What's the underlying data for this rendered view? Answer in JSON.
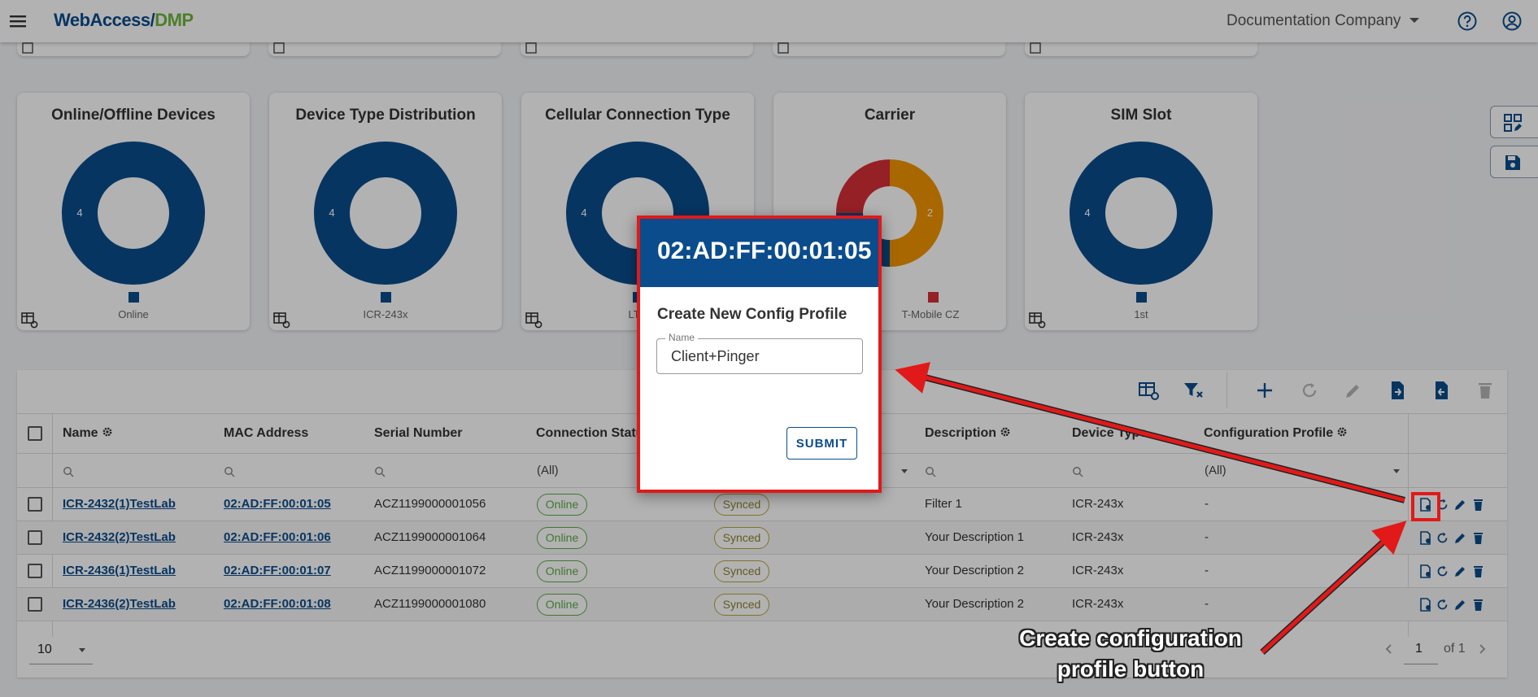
{
  "header": {
    "logo_part1": "WebAccess/",
    "logo_part2": "DMP",
    "company": "Documentation Company"
  },
  "cards": [
    {
      "title": "Online/Offline Devices",
      "legend": "Online",
      "slices": [
        {
          "label": "4",
          "value": 4,
          "color": "#0b4c8c"
        }
      ]
    },
    {
      "title": "Device Type Distribution",
      "legend": "ICR-243x",
      "slices": [
        {
          "label": "4",
          "value": 4,
          "color": "#0b4c8c"
        }
      ]
    },
    {
      "title": "Cellular Connection Type",
      "legend": "LTE",
      "slices": [
        {
          "label": "4",
          "value": 4,
          "color": "#0b4c8c"
        }
      ]
    },
    {
      "title": "Carrier",
      "legend": "T-Mobile CZ",
      "slices": [
        {
          "label": "2",
          "value": 2,
          "color": "#f29400"
        },
        {
          "label": "1",
          "value": 1,
          "color": "#0b4c8c"
        },
        {
          "label": "",
          "value": 1,
          "color": "#d62e37"
        }
      ]
    },
    {
      "title": "SIM Slot",
      "legend": "1st",
      "slices": [
        {
          "label": "4",
          "value": 4,
          "color": "#0b4c8c"
        }
      ]
    }
  ],
  "table": {
    "columns": [
      "Name",
      "MAC Address",
      "Serial Number",
      "Connection Status",
      "Description",
      "Device Type",
      "Configuration Profile"
    ],
    "filters": {
      "connection_status": "(All)",
      "configuration_profile": "(All)"
    },
    "rows": [
      {
        "name": "ICR-2432(1)TestLab",
        "mac": "02:AD:FF:00:01:05",
        "serial": "ACZ1199000001056",
        "status": "Online",
        "sync": "Synced",
        "description": "Filter 1",
        "device_type": "ICR-243x",
        "profile": "-"
      },
      {
        "name": "ICR-2432(2)TestLab",
        "mac": "02:AD:FF:00:01:06",
        "serial": "ACZ1199000001064",
        "status": "Online",
        "sync": "Synced",
        "description": "Your Description 1",
        "device_type": "ICR-243x",
        "profile": "-"
      },
      {
        "name": "ICR-2436(1)TestLab",
        "mac": "02:AD:FF:00:01:07",
        "serial": "ACZ1199000001072",
        "status": "Online",
        "sync": "Synced",
        "description": "Your Description 2",
        "device_type": "ICR-243x",
        "profile": "-"
      },
      {
        "name": "ICR-2436(2)TestLab",
        "mac": "02:AD:FF:00:01:08",
        "serial": "ACZ1199000001080",
        "status": "Online",
        "sync": "Synced",
        "description": "Your Description 2",
        "device_type": "ICR-243x",
        "profile": "-"
      }
    ]
  },
  "pager": {
    "page_size": "10",
    "page": "1",
    "of_label": "of 1"
  },
  "dialog": {
    "title": "02:AD:FF:00:01:05",
    "subtitle": "Create New Config Profile",
    "field_label": "Name",
    "field_value": "Client+Pinger",
    "submit_label": "SUBMIT"
  },
  "annotation": {
    "line1": "Create configuration",
    "line2": "profile button"
  },
  "colors": {
    "brand_blue": "#0b4c8c",
    "brand_green": "#6fb53b",
    "online": "#5cab46",
    "annotation_red": "#e11919"
  }
}
